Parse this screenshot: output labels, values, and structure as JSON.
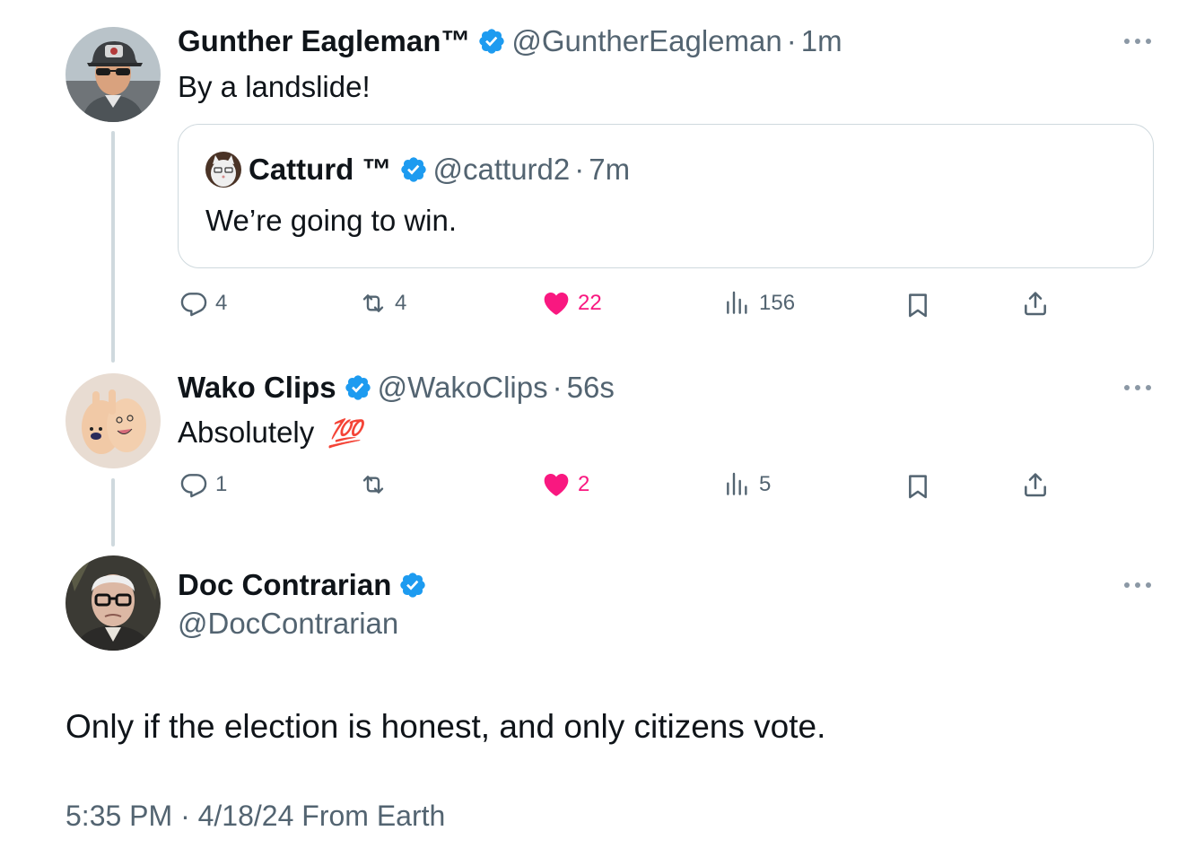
{
  "colors": {
    "verified": "#1d9bf0",
    "like": "#f91880",
    "muted": "#536471",
    "line": "#cfd9de"
  },
  "tweets": [
    {
      "name": "Gunther Eagleman™",
      "handle": "@GuntherEagleman",
      "time": "1m",
      "text": "By a landslide!",
      "quote": {
        "name": "Catturd ™",
        "handle": "@catturd2",
        "time": "7m",
        "text": "We’re going to win."
      },
      "actions": {
        "replies": "4",
        "reposts": "4",
        "likes": "22",
        "views": "156"
      }
    },
    {
      "name": "Wako Clips",
      "handle": "@WakoClips",
      "time": "56s",
      "text": "Absolutely",
      "emoji": "💯",
      "actions": {
        "replies": "1",
        "reposts": "",
        "likes": "2",
        "views": "5"
      }
    }
  ],
  "main": {
    "name": "Doc Contrarian",
    "handle": "@DocContrarian",
    "text": "Only if the election is honest, and only citizens vote.",
    "time": "5:35 PM",
    "date": "4/18/24",
    "source": "From Earth"
  },
  "icons": [
    "reply-icon",
    "repost-icon",
    "like-icon",
    "views-icon",
    "bookmark-icon",
    "share-icon",
    "verified-badge-icon",
    "more-icon"
  ]
}
